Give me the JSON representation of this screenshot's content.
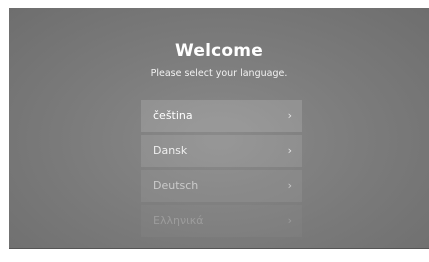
{
  "screen": {
    "title": "Welcome",
    "subtitle": "Please select your language."
  },
  "languages": [
    {
      "label": "čeština",
      "chevron": "›"
    },
    {
      "label": "Dansk",
      "chevron": "›"
    },
    {
      "label": "Deutsch",
      "chevron": "›"
    },
    {
      "label": "Ελληνικά",
      "chevron": "›"
    }
  ],
  "icons": {
    "chevron": "chevron-right-icon"
  },
  "colors": {
    "background": "#7a7a7a",
    "text": "#ffffff"
  }
}
